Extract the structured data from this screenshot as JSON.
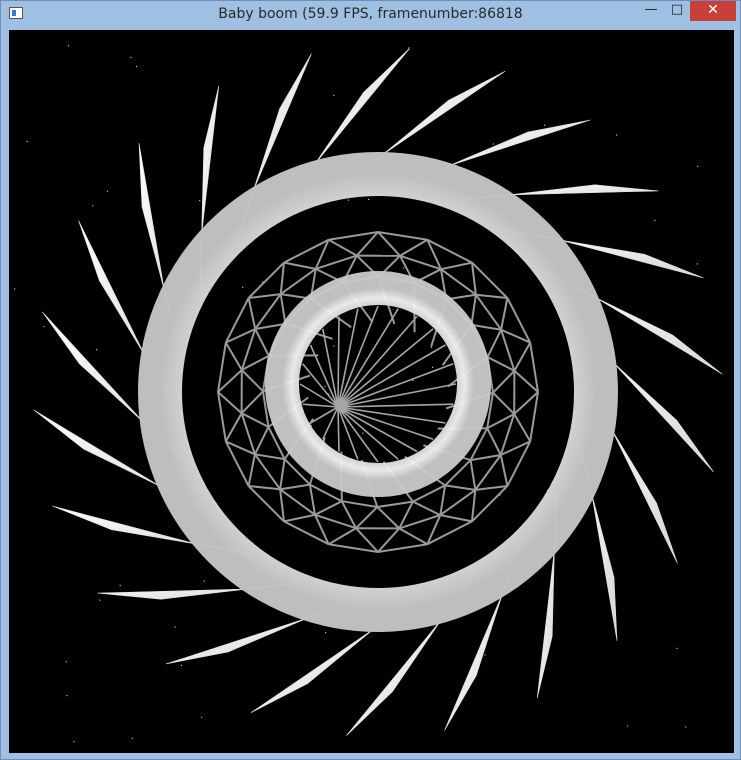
{
  "window": {
    "title": "Baby boom (59.9 FPS, framenumber:86818",
    "minimize_glyph": "—",
    "maximize_glyph": "□",
    "close_glyph": "✕"
  },
  "scene": {
    "background": "#000000",
    "surface_color": "#f4f4f4",
    "wire_color": "#9a9a9a"
  }
}
